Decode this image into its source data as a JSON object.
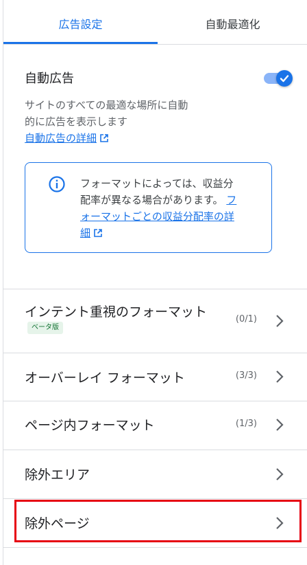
{
  "tabs": [
    {
      "label": "広告設定",
      "active": true
    },
    {
      "label": "自動最適化",
      "active": false
    }
  ],
  "auto_ads": {
    "title": "自動広告",
    "enabled": true,
    "description_line1": "サイトのすべての最適な場所に自動",
    "description_line2": "的に広告を表示します",
    "details_link": "自動広告の詳細"
  },
  "info": {
    "icon": "info-icon",
    "text_line1": "フォーマットによっては、収益分",
    "text_line2": "配率が異なる場合があります。",
    "link_line2": "フ",
    "link_line3": "ォーマットごとの収益分配率の詳",
    "link_line4": "細"
  },
  "rows": [
    {
      "label": "インテント重視のフォーマット",
      "count": "(0/1)",
      "badge": "ベータ版"
    },
    {
      "label": "オーバーレイ フォーマット",
      "count": "(3/3)"
    },
    {
      "label": "ページ内フォーマット",
      "count": "(1/3)"
    },
    {
      "label": "除外エリア",
      "count": ""
    },
    {
      "label": "除外ページ",
      "count": ""
    }
  ],
  "colors": {
    "accent": "#1a73e8",
    "highlight": "#e60012",
    "beta_bg": "#e6f4ea",
    "beta_text": "#137333"
  }
}
